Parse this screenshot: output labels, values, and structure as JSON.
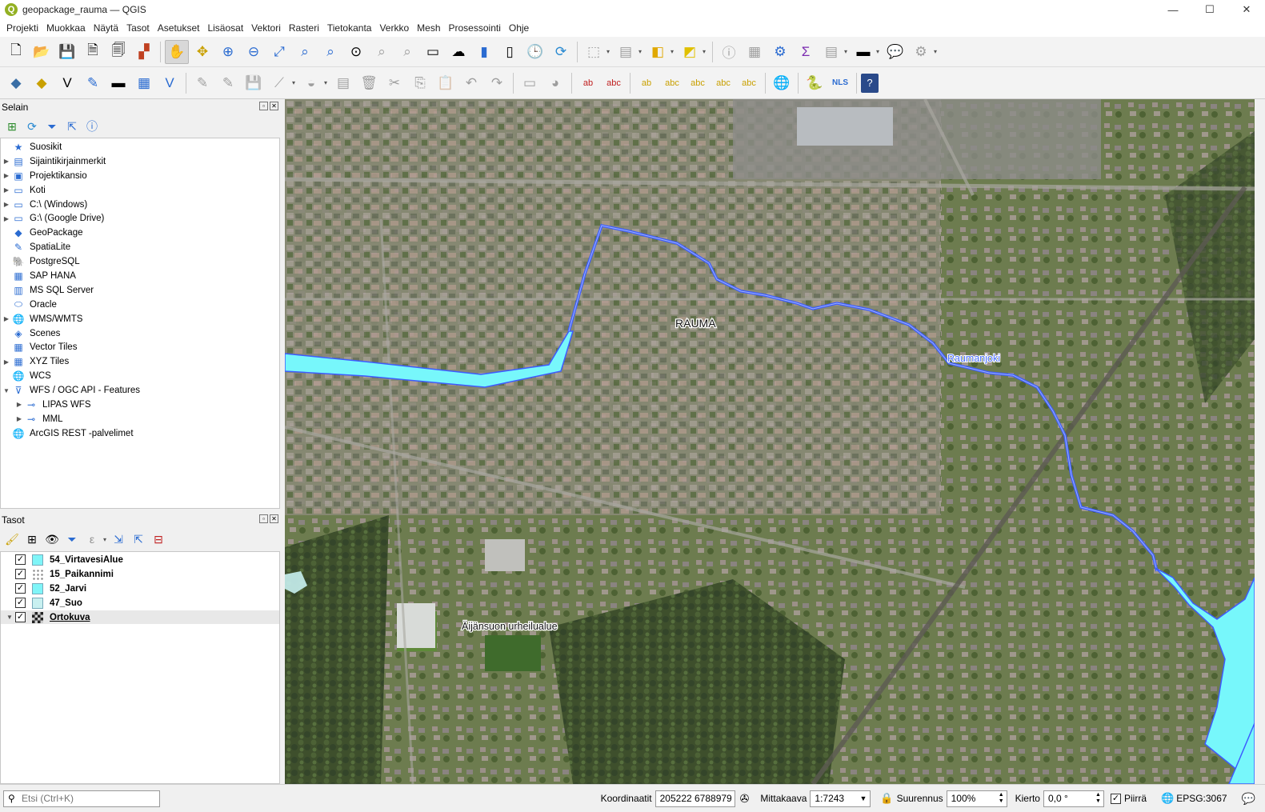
{
  "window": {
    "title": "geopackage_rauma — QGIS",
    "minimize": "—",
    "maximize": "☐",
    "close": "✕",
    "app_icon": "Q"
  },
  "menu": [
    "Projekti",
    "Muokkaa",
    "Näytä",
    "Tasot",
    "Asetukset",
    "Lisäosat",
    "Vektori",
    "Rasteri",
    "Tietokanta",
    "Verkko",
    "Mesh",
    "Prosessointi",
    "Ohje"
  ],
  "browser": {
    "title": "Selain",
    "items": [
      {
        "label": "Suosikit",
        "icon": "★",
        "expand": ""
      },
      {
        "label": "Sijaintikirjainmerkit",
        "icon": "▤",
        "expand": "▶"
      },
      {
        "label": "Projektikansio",
        "icon": "▣",
        "expand": "▶"
      },
      {
        "label": "Koti",
        "icon": "▭",
        "expand": "▶"
      },
      {
        "label": "C:\\ (Windows)",
        "icon": "▭",
        "expand": "▶"
      },
      {
        "label": "G:\\ (Google Drive)",
        "icon": "▭",
        "expand": "▶"
      },
      {
        "label": "GeoPackage",
        "icon": "◆",
        "expand": ""
      },
      {
        "label": "SpatiaLite",
        "icon": "✎",
        "expand": ""
      },
      {
        "label": "PostgreSQL",
        "icon": "🐘",
        "expand": ""
      },
      {
        "label": "SAP HANA",
        "icon": "▦",
        "expand": ""
      },
      {
        "label": "MS SQL Server",
        "icon": "▥",
        "expand": ""
      },
      {
        "label": "Oracle",
        "icon": "⬭",
        "expand": ""
      },
      {
        "label": "WMS/WMTS",
        "icon": "🌐",
        "expand": "▶"
      },
      {
        "label": "Scenes",
        "icon": "◈",
        "expand": ""
      },
      {
        "label": "Vector Tiles",
        "icon": "▦",
        "expand": ""
      },
      {
        "label": "XYZ Tiles",
        "icon": "▦",
        "expand": "▶"
      },
      {
        "label": "WCS",
        "icon": "🌐",
        "expand": ""
      },
      {
        "label": "WFS / OGC API - Features",
        "icon": "⊽",
        "expand": "▼"
      },
      {
        "label": "LIPAS WFS",
        "icon": "⊸",
        "expand": "▶",
        "indent": true
      },
      {
        "label": "MML",
        "icon": "⊸",
        "expand": "▶",
        "indent": true
      },
      {
        "label": "ArcGIS REST -palvelimet",
        "icon": "🌐",
        "expand": ""
      }
    ]
  },
  "layers": {
    "title": "Tasot",
    "items": [
      {
        "name": "54_VirtavesiAlue",
        "checked": "✓",
        "swatch": "#7ff5f8"
      },
      {
        "name": "15_Paikannimi",
        "checked": "✓",
        "swatch": "dots"
      },
      {
        "name": "52_Jarvi",
        "checked": "✓",
        "swatch": "#7ff5f8"
      },
      {
        "name": "47_Suo",
        "checked": "✓",
        "swatch": "#c8f0f0"
      },
      {
        "name": "Ortokuva",
        "checked": "✓",
        "swatch": "raster"
      }
    ]
  },
  "map": {
    "labels": [
      {
        "text": "RAUMA"
      },
      {
        "text": "Raumanjoki"
      },
      {
        "text": "Äijänsuon urheilualue"
      }
    ],
    "water_color": "#77f7fb",
    "river_color": "#3d5cff"
  },
  "status": {
    "search_placeholder": "Etsi (Ctrl+K)",
    "coord_label": "Koordinaatit",
    "coord_value": "205222  6788979",
    "scale_label": "Mittakaava",
    "scale_value": "1:7243",
    "magnifier_label": "Suurennus",
    "magnifier_value": "100%",
    "rotation_label": "Kierto",
    "rotation_value": "0,0 °",
    "render_label": "Piirrä",
    "crs": "EPSG:3067"
  },
  "toolbar2_text": {
    "nls": "NLS"
  }
}
